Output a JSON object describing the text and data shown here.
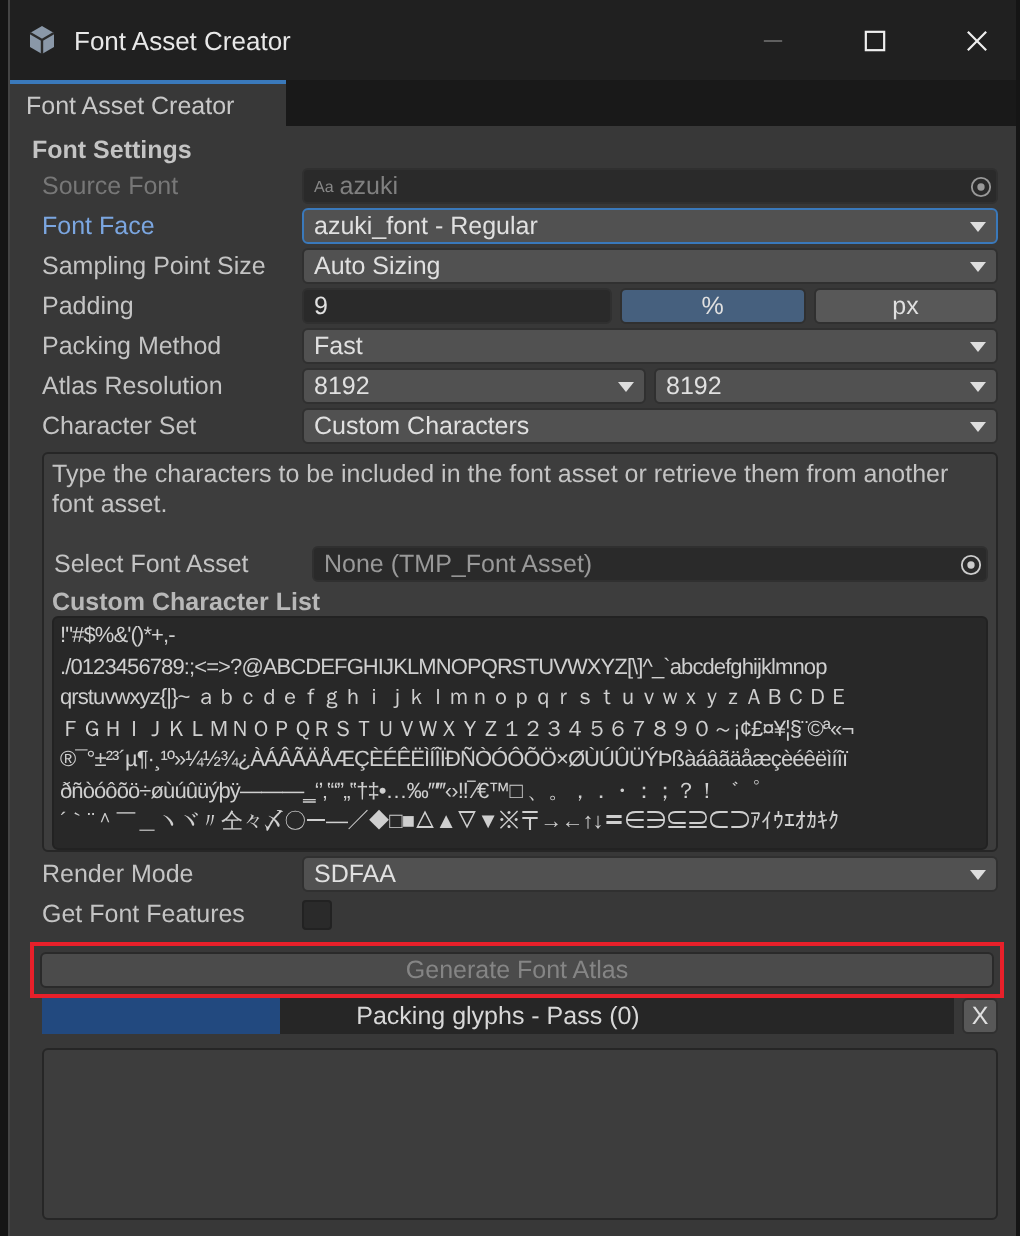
{
  "window": {
    "title": "Font Asset Creator"
  },
  "tabs": [
    {
      "label": "Font Asset Creator",
      "selected": true
    }
  ],
  "section_title": "Font Settings",
  "fields": [
    {
      "kind": "object",
      "label": "Source Font",
      "icon": "Aa",
      "value": "azuki",
      "disabled": true,
      "focused": false
    },
    {
      "kind": "dropdown",
      "label": "Font Face",
      "value": "azuki_font - Regular",
      "disabled": false,
      "focused": true
    },
    {
      "kind": "dropdown",
      "label": "Sampling Point Size",
      "value": "Auto Sizing",
      "disabled": false,
      "focused": false
    },
    {
      "kind": "padding",
      "label": "Padding",
      "value": "9",
      "disabled": false,
      "focused": false,
      "units": [
        {
          "label": "%",
          "selected": true
        },
        {
          "label": "px",
          "selected": false
        }
      ]
    },
    {
      "kind": "dropdown",
      "label": "Packing Method",
      "value": "Fast",
      "disabled": false,
      "focused": false
    },
    {
      "kind": "pair",
      "label": "Atlas Resolution",
      "value": "8192",
      "value_2": "8192",
      "disabled": false,
      "focused": false
    },
    {
      "kind": "dropdown",
      "label": "Character Set",
      "value": "Custom Characters",
      "disabled": false,
      "focused": false
    }
  ],
  "character_panel": {
    "help": "Type the characters to be included in the font asset or retrieve them from another font asset.",
    "select_label": "Select Font Asset",
    "select_value": "None (TMP_Font Asset)",
    "list_title": "Custom Character List",
    "lines": [
      "!\"#$%&'()*+,-",
      "./0123456789:;<=>?@ABCDEFGHIJKLMNOPQRSTUVWXYZ[\\]^_`abcdefghijklmnop",
      "qrstuvwxyz{|}~ ａｂｃｄｅｆｇｈｉｊｋｌｍｎｏｐｑｒｓｔｕｖｗｘｙｚＡＢＣＤＥ",
      "ＦＧＨＩＪＫＬＭＮＯＰＱＲＳＴＵＶＷＸＹＺ１２３４５６７８９０～¡¢£¤¥¦§¨©ª«¬",
      "®¯°±²³´µ¶·¸¹º»¼½¾¿ÀÁÂÃÄÅÆÇÈÉÊËÌÍÎÏÐÑÒÓÔÕÖ×ØÙÚÛÜÝÞßàáâãäåæçèéêëìíîï",
      "ðñòóôõö÷øùúûüýþÿ―――‗‘’‚‛“”„‟†‡•…‰′″‴‹›‼‾⁄€™□ 、。，．・：；？！゛゜",
      "´｀¨＾￣＿ヽヾ〃仝々〆〇ー―／◆□■△▲▽▼※〒→←↑↓〓∈∋⊆⊇⊂⊃ｱｲｳｴｵｶｷｸ"
    ]
  },
  "render_mode": {
    "label": "Render Mode",
    "value": "SDFAA"
  },
  "features": {
    "label": "Get Font Features",
    "checked": false
  },
  "generate_button": {
    "label": "Generate Font Atlas",
    "disabled": true,
    "highlighted": true
  },
  "progress": {
    "label": "Packing glyphs - Pass (0)",
    "level": 0.26,
    "cancel": "X"
  }
}
